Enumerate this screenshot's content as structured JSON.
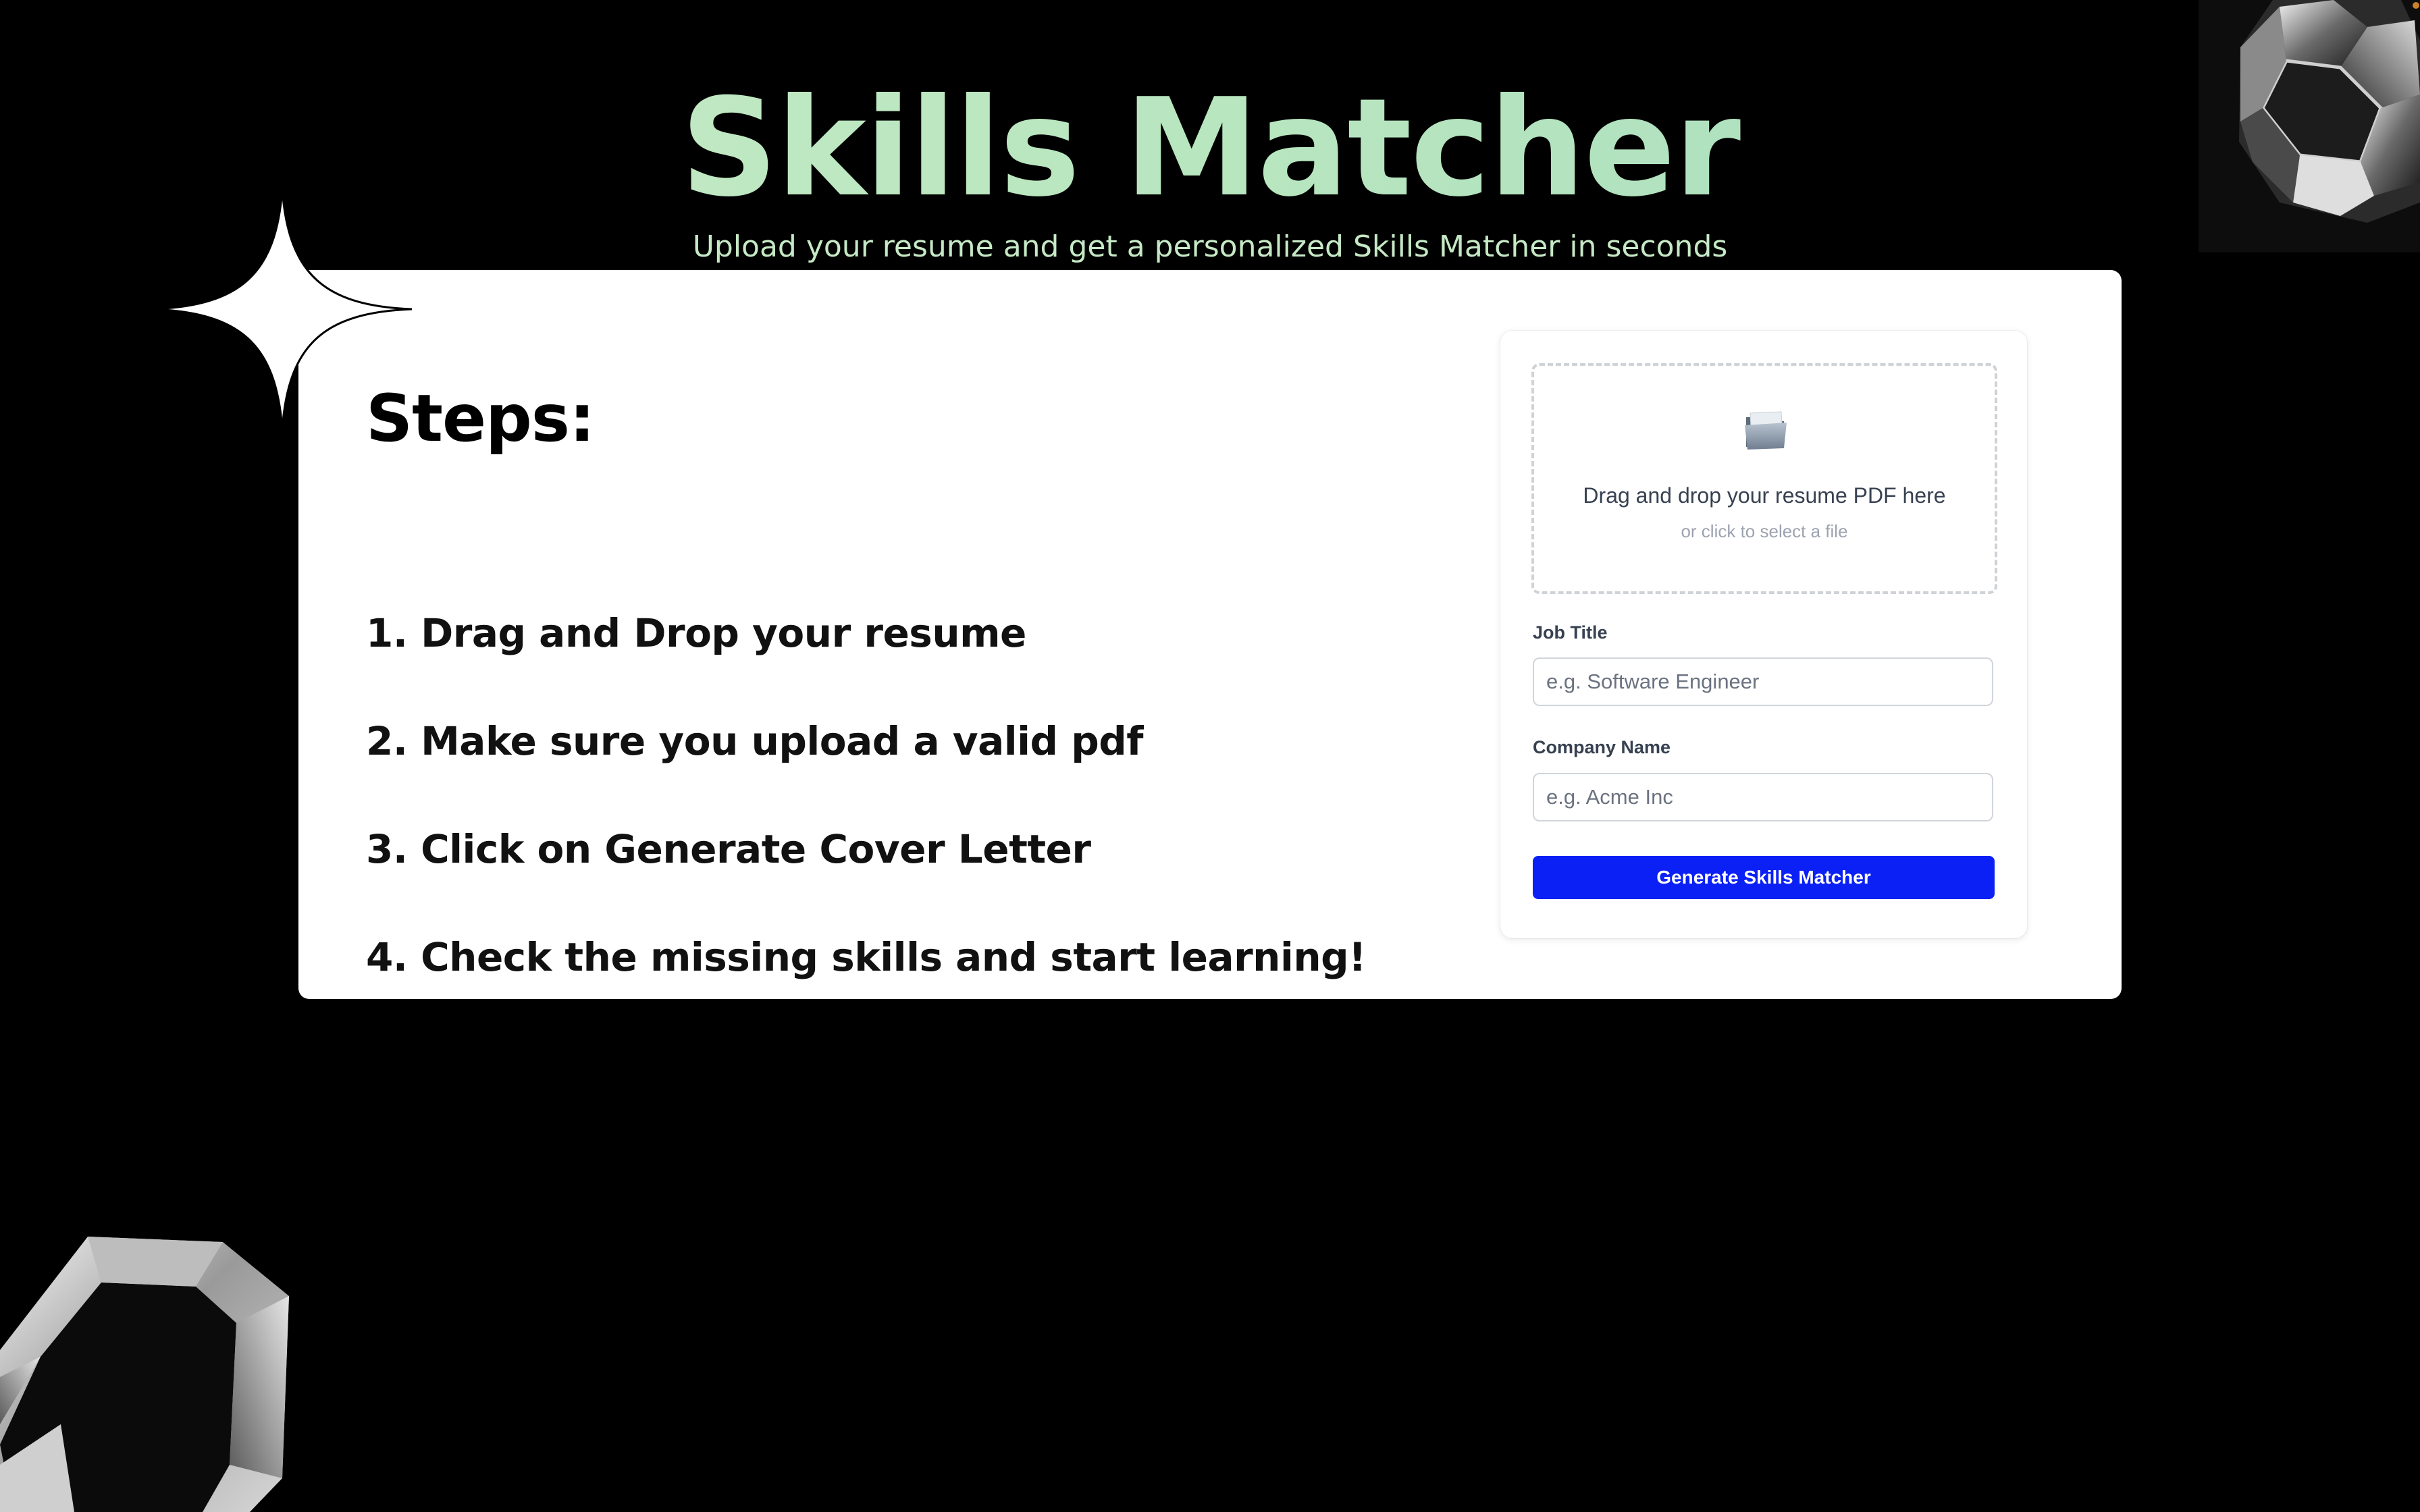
{
  "header": {
    "title": "Skills Matcher",
    "subtitle": "Upload your resume and get a personalized Skills Matcher in seconds"
  },
  "steps": {
    "heading": "Steps:",
    "items": [
      "1. Drag and Drop your resume",
      "2. Make sure you upload a valid pdf",
      "3. Click on Generate Cover Letter",
      "4. Check the missing skills and start learning!"
    ]
  },
  "upload": {
    "icon": "folder-icon",
    "primary_text": "Drag and drop your resume PDF here",
    "secondary_text": "or click to select a file"
  },
  "form": {
    "job_title_label": "Job Title",
    "job_title_placeholder": "e.g. Software Engineer",
    "job_title_value": "",
    "company_name_label": "Company Name",
    "company_name_placeholder": "e.g. Acme Inc",
    "company_name_value": "",
    "submit_label": "Generate Skills Matcher"
  },
  "colors": {
    "background": "#000000",
    "title_gradient_start": "#c9ebc8",
    "title_gradient_end": "#a7dcc0",
    "subtitle": "#c6e9c5",
    "card": "#ffffff",
    "primary_button": "#0a20f5"
  }
}
